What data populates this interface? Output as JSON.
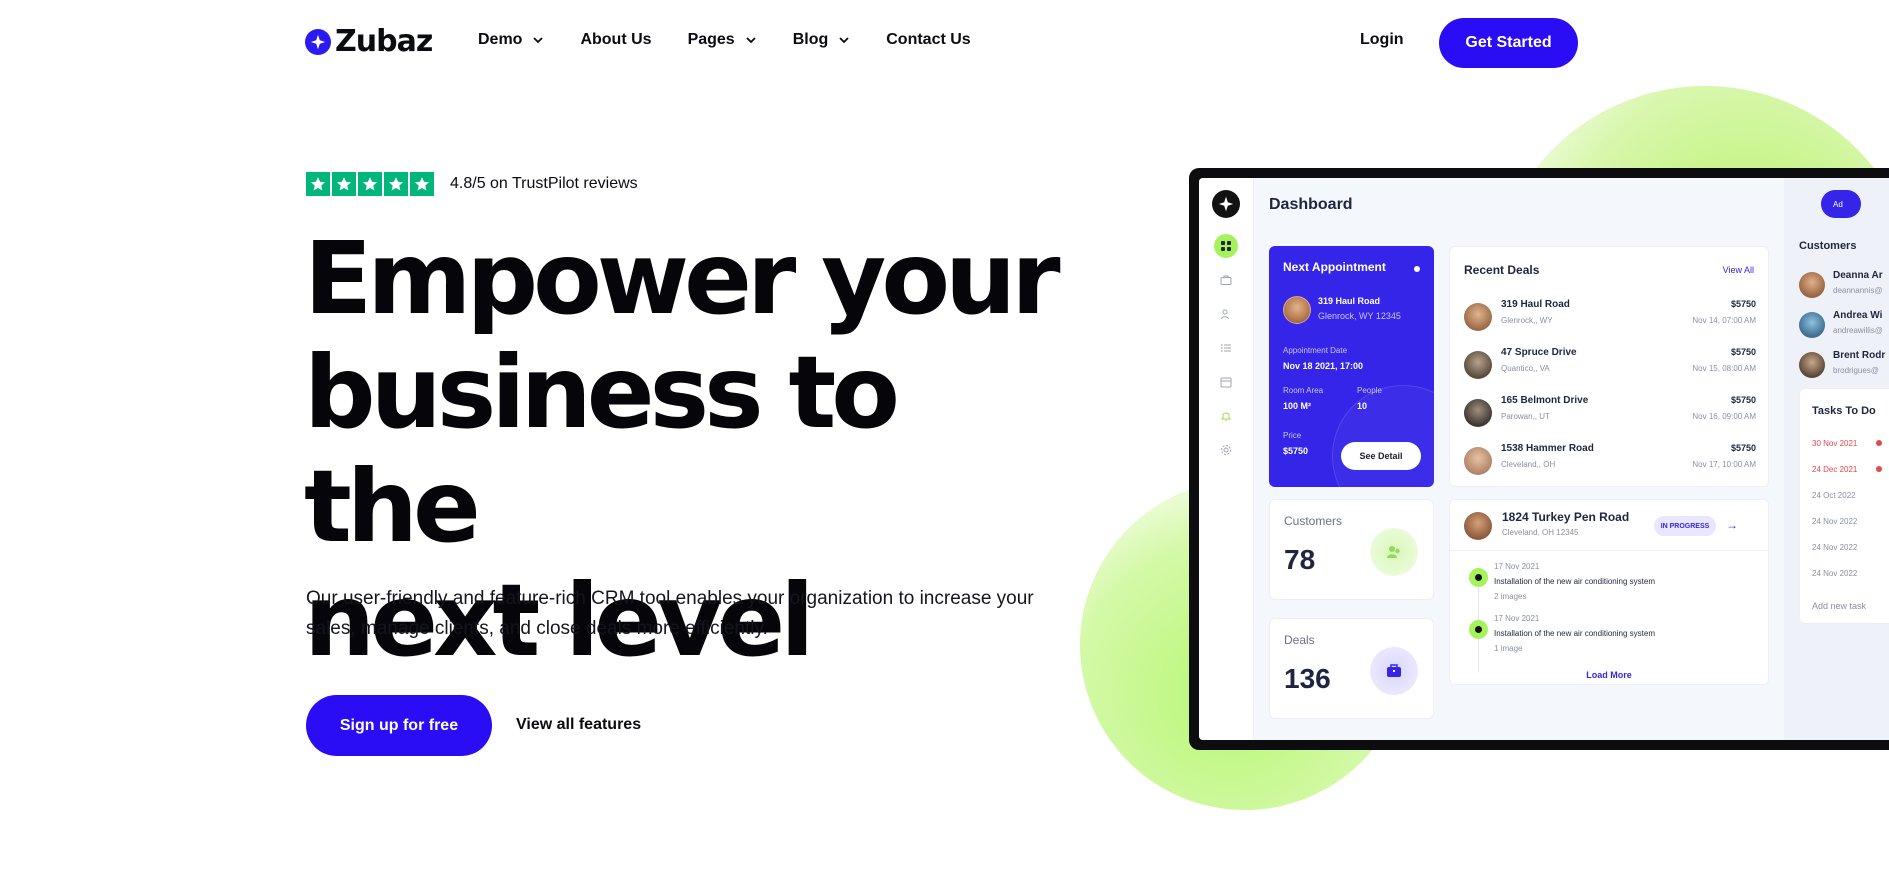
{
  "nav": {
    "brand": "Zubaz",
    "menu": [
      {
        "label": "Demo",
        "has_dropdown": true
      },
      {
        "label": "About Us",
        "has_dropdown": false
      },
      {
        "label": "Pages",
        "has_dropdown": true
      },
      {
        "label": "Blog",
        "has_dropdown": true
      },
      {
        "label": "Contact Us",
        "has_dropdown": false
      }
    ],
    "login": "Login",
    "cta": "Get Started"
  },
  "hero": {
    "rating_text": "4.8/5 on TrustPilot reviews",
    "stars": 5,
    "headline_lines": [
      "Empower your",
      "business to the",
      "next level"
    ],
    "subtext": "Our user-friendly and feature-rich CRM tool enables your organization to increase your sales, manage clients, and close deals more efficiently.",
    "primary_cta": "Sign up for free",
    "secondary_cta": "View all features"
  },
  "dashboard": {
    "title": "Dashboard",
    "add_button": "Ad",
    "sidebar_icons": [
      "grid-icon",
      "briefcase-icon",
      "users-icon",
      "list-icon",
      "calendar-icon",
      "bell-icon",
      "settings-icon"
    ],
    "appointment": {
      "title": "Next Appointment",
      "address": "319 Haul Road",
      "city": "Glenrock, WY 12345",
      "date_label": "Appointment Date",
      "date_value": "Nov 18 2021, 17:00",
      "area_label": "Room Area",
      "area_value": "100  M²",
      "people_label": "People",
      "people_value": "10",
      "price_label": "Price",
      "price_value": "$5750",
      "button": "See Detail"
    },
    "customers_stat": {
      "label": "Customers",
      "value": "78"
    },
    "deals_stat": {
      "label": "Deals",
      "value": "136"
    },
    "recent_deals": {
      "title": "Recent Deals",
      "view_all": "View All",
      "items": [
        {
          "name": "319 Haul Road",
          "city": "Glenrock,, WY",
          "price": "$5750",
          "date": "Nov 14, 07:00 AM"
        },
        {
          "name": "47 Spruce Drive",
          "city": "Quantico,, VA",
          "price": "$5750",
          "date": "Nov 15, 08:00 AM"
        },
        {
          "name": "165 Belmont Drive",
          "city": "Parowan,, UT",
          "price": "$5750",
          "date": "Nov 16, 09:00 AM"
        },
        {
          "name": "1538 Hammer Road",
          "city": "Cleveland,, OH",
          "price": "$5750",
          "date": "Nov 17, 10:00 AM"
        }
      ]
    },
    "activity": {
      "title": "1824 Turkey Pen Road",
      "city": "Cleveland, OH 12345",
      "status": "IN PROGRESS",
      "entries": [
        {
          "date": "17 Nov 2021",
          "text": "Installation of the new air conditioning system",
          "sub": "2 images"
        },
        {
          "date": "17 Nov 2021",
          "text": "Installation of the new air conditioning system",
          "sub": "1 image"
        }
      ],
      "load_more": "Load More"
    },
    "customers": {
      "title": "Customers",
      "items": [
        {
          "name": "Deanna Ar",
          "email": "deannannis@"
        },
        {
          "name": "Andrea Wi",
          "email": "andreawillis@"
        },
        {
          "name": "Brent Rodr",
          "email": "brodrigues@"
        }
      ]
    },
    "tasks": {
      "title": "Tasks To Do",
      "items": [
        {
          "date": "30 Nov 2021",
          "overdue": true
        },
        {
          "date": "24 Dec 2021",
          "overdue": true
        },
        {
          "date": "24 Oct 2022",
          "overdue": false
        },
        {
          "date": "24 Nov 2022",
          "overdue": false
        },
        {
          "date": "24 Nov 2022",
          "overdue": false
        },
        {
          "date": "24 Nov 2022",
          "overdue": false
        }
      ],
      "add_placeholder": "Add new task"
    }
  },
  "colors": {
    "brand_blue": "#2a0cf5",
    "accent_green": "#a6f25a",
    "trustpilot_green": "#00b67a",
    "alert_red": "#e5484d"
  }
}
